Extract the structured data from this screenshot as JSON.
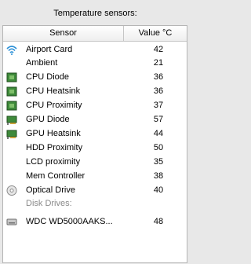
{
  "panel_title": "Temperature sensors:",
  "columns": {
    "sensor": "Sensor",
    "value": "Value °C"
  },
  "rows": [
    {
      "name": "Airport Card",
      "value": "42",
      "icon": "wifi-icon"
    },
    {
      "name": "Ambient",
      "value": "21",
      "icon": ""
    },
    {
      "name": "CPU Diode",
      "value": "36",
      "icon": "cpu-chip-icon"
    },
    {
      "name": "CPU Heatsink",
      "value": "36",
      "icon": "cpu-chip-icon"
    },
    {
      "name": "CPU Proximity",
      "value": "37",
      "icon": "cpu-chip-icon"
    },
    {
      "name": "GPU Diode",
      "value": "57",
      "icon": "gpu-card-icon"
    },
    {
      "name": "GPU Heatsink",
      "value": "44",
      "icon": "gpu-card-icon"
    },
    {
      "name": "HDD Proximity",
      "value": "50",
      "icon": ""
    },
    {
      "name": "LCD proximity",
      "value": "35",
      "icon": ""
    },
    {
      "name": "Mem Controller",
      "value": "38",
      "icon": ""
    },
    {
      "name": "Optical Drive",
      "value": "40",
      "icon": "optical-disc-icon"
    }
  ],
  "group_label": "Disk Drives:",
  "disk_rows": [
    {
      "name": "WDC WD5000AAKS...",
      "value": "48",
      "icon": "hard-drive-icon"
    }
  ],
  "colors": {
    "accent": "#2a8fd6",
    "chip_green": "#3e8a3a",
    "group_text": "#8a8a8a"
  }
}
